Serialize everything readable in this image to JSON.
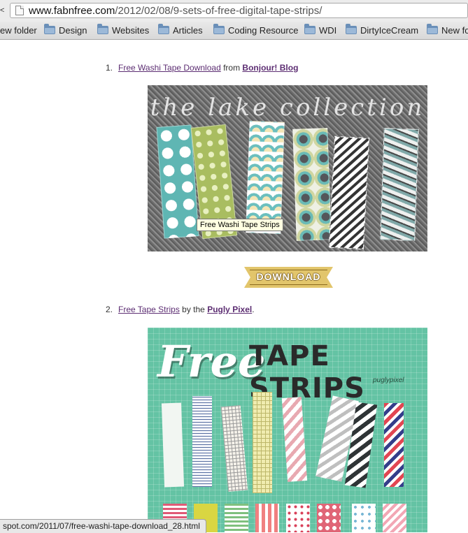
{
  "address_bar": {
    "host": "www.fabnfree.com",
    "path": "/2012/02/08/9-sets-of-free-digital-tape-strips/",
    "back_glyph": "&lt;"
  },
  "bookmarks": [
    "ew folder",
    "Design",
    "Websites",
    "Articles",
    "Coding Resource",
    "WDI",
    "DirtyIceCream",
    "New fo"
  ],
  "list": [
    {
      "number": "1.",
      "link_text": "Free Washi Tape Download",
      "connector": " from ",
      "source_text": "Bonjour! Blog"
    },
    {
      "number": "2.",
      "link_text": "Free Tape Strips",
      "connector": " by the ",
      "source_text": "Pugly Pixel",
      "trailing": "."
    }
  ],
  "image1": {
    "title": "the lake collection",
    "tooltip": "Free Washi Tape Strips"
  },
  "download_button": {
    "label": "DOWNLOAD"
  },
  "image2": {
    "free": "Free",
    "tape_strips": "TAPE STRIPS",
    "brand": "puglypixel"
  },
  "status_bar": {
    "text": "spot.com/2011/07/free-washi-tape-download_28.html"
  },
  "colors": {
    "link": "#5c2d72",
    "tape_bg": "#64c3a4",
    "download_gold": "#e2c56b"
  }
}
